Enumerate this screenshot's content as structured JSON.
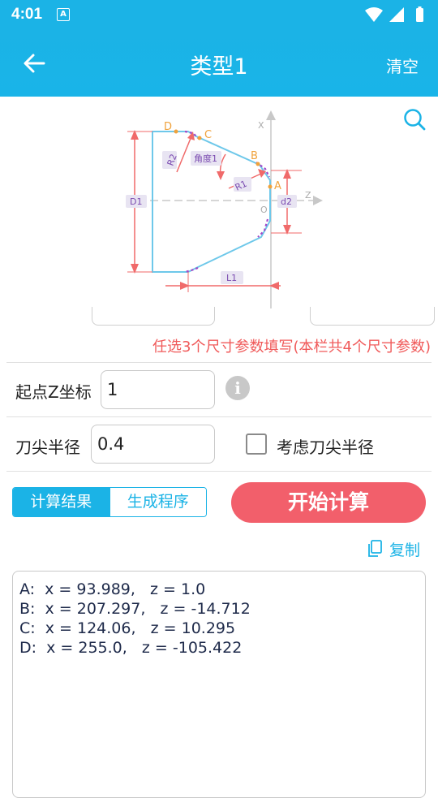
{
  "status": {
    "time": "4:01",
    "a_icon": "A"
  },
  "appbar": {
    "title": "类型1",
    "clear_label": "清空"
  },
  "diagram": {
    "labels": {
      "D": "D",
      "C": "C",
      "B": "B",
      "A": "A",
      "X": "X",
      "Z": "Z",
      "O": "O",
      "R2": "R2",
      "R1": "R1",
      "angle": "角度1",
      "D1": "D1",
      "d2": "d2",
      "L1": "L1"
    }
  },
  "hint": "任选3个尺寸参数填写(本栏共4个尺寸参数)",
  "fields": {
    "start_z_label": "起点Z坐标",
    "start_z_value": "1",
    "tip_radius_label": "刀尖半径",
    "tip_radius_value": "0.4",
    "consider_tip_label": "考虑刀尖半径"
  },
  "tabs": {
    "result": "计算结果",
    "program": "生成程序"
  },
  "start_button": "开始计算",
  "copy_label": "复制",
  "results": [
    "A:  x = 93.989,   z = 1.0",
    "B:  x = 207.297,   z = -14.712",
    "C:  x = 124.06,   z = 10.295",
    "D:  x = 255.0,   z = -105.422"
  ],
  "colors": {
    "primary": "#1bb3e6",
    "accent": "#f25f6b",
    "hint": "#f05a5a"
  }
}
